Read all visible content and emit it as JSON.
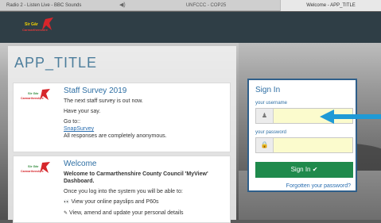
{
  "browser": {
    "tabs": [
      {
        "label": "Radio 2 - Listen Live - BBC Sounds"
      },
      {
        "label": "UNFCCC - COP25"
      },
      {
        "label": "Welcome - APP_TITLE",
        "active": true
      }
    ],
    "speaker_icon": "speaker-icon"
  },
  "header": {
    "logo_text_top": "Sir Gâr",
    "logo_text_bottom": "Carmarthenshire"
  },
  "main": {
    "app_title": "APP_TITLE",
    "cards": [
      {
        "title": "Staff Survey 2019",
        "line1": "The next staff survey is out now.",
        "line2": "Have your say.",
        "line3": "Go to::",
        "link": "SnapSurvey",
        "line4": "All responses are completely anonymous."
      },
      {
        "title": "Welcome",
        "line1": "Welcome to Carmarthenshire County Council 'MyView' Dashboard.",
        "line2": "Once you log into the system you will be able to:",
        "bullet1": "View your online payslips and P60s",
        "bullet2": "View, amend and update your personal details"
      }
    ]
  },
  "signin": {
    "title": "Sign In",
    "username_label": "your username",
    "username_value": "",
    "password_label": "your password",
    "password_value": "",
    "button_label": "Sign In ✔",
    "forgot_link": "Forgotten your password?"
  },
  "colors": {
    "accent": "#2d6ea3",
    "button": "#1f8a4c",
    "header": "#2f3e46",
    "arrow": "#1f9ad6"
  }
}
